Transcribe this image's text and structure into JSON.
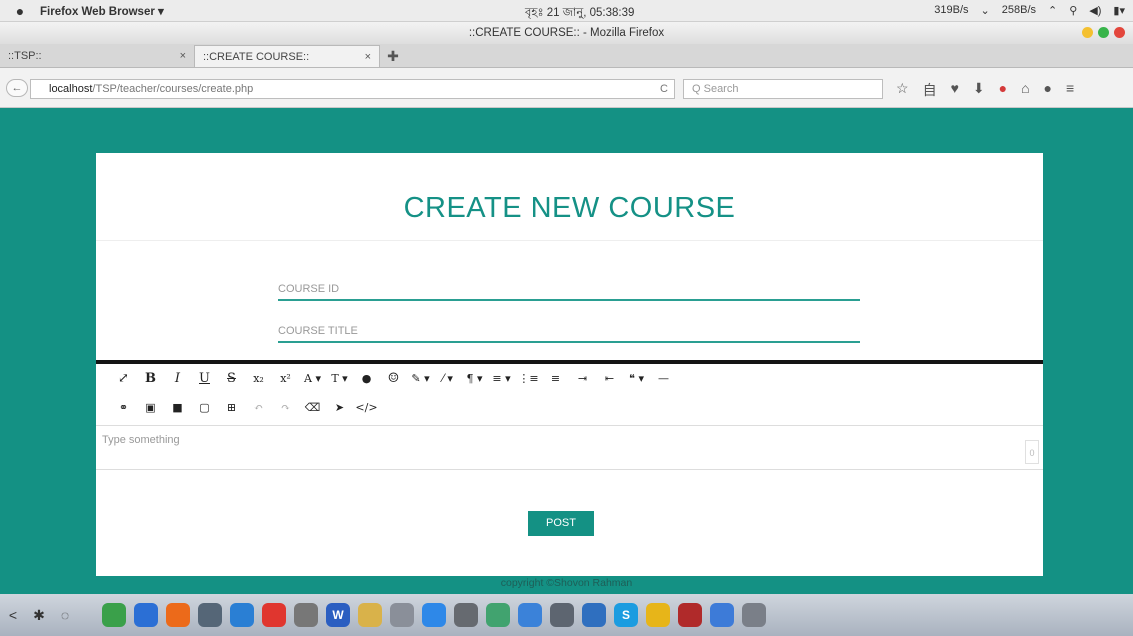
{
  "menubar": {
    "app_name": "Firefox Web Browser ▾",
    "clock": "বৃহঃ 21 জানু, 05:38:39",
    "status": [
      "319B/s",
      "⌄",
      "258B/s",
      "⌃",
      "⚲",
      "◀)",
      "▮▾"
    ]
  },
  "window": {
    "title": "::CREATE COURSE:: - Mozilla Firefox"
  },
  "tabs": [
    {
      "label": "::TSP::",
      "close": "×"
    },
    {
      "label": "::CREATE COURSE::",
      "close": "×"
    }
  ],
  "newtab_label": "✚",
  "nav": {
    "back": "←",
    "url_host": "localhost",
    "url_path": "/TSP/teacher/courses/create.php",
    "reload": "C",
    "search_placeholder": "Q Search",
    "icons": [
      "star-icon",
      "reading-list-icon",
      "pocket-icon",
      "download-icon",
      "addon-icon",
      "home-icon",
      "chat-icon",
      "menu-icon"
    ],
    "icon_glyphs": [
      "☆",
      "自",
      "♥",
      "⬇",
      "●",
      "⌂",
      "●",
      "≡"
    ]
  },
  "form": {
    "heading": "CREATE NEW COURSE",
    "course_id_placeholder": "COURSE ID",
    "course_title_placeholder": "COURSE TITLE",
    "editor_placeholder": "Type something",
    "editor_counter": "0",
    "post_button": "POST"
  },
  "toolbar": {
    "row1": [
      "⤢",
      "B",
      "I",
      "U",
      "S",
      "x₂",
      "x²",
      "A ▾",
      "T ▾",
      "●",
      "☺",
      "✎ ▾",
      "⁄ ▾",
      "¶ ▾",
      "≡ ▾",
      "⋮≡",
      "≡",
      "⇥",
      "⇤",
      "❝ ▾",
      "—"
    ],
    "row2": [
      "⚭",
      "▣",
      "■",
      "▢",
      "⊞",
      "↶",
      "↷",
      "⌫",
      "➤",
      "</>"
    ]
  },
  "footer": "copyright ©Shovon Rahman",
  "dock": {
    "left_controls": [
      "<",
      "✱",
      "◌"
    ],
    "apps": [
      "green",
      "blue",
      "orange",
      "gray",
      "blue2",
      "red",
      "gray2",
      "blue3",
      "gold",
      "gray3",
      "blue4",
      "gray5",
      "green2",
      "blue5",
      "gray6",
      "blue6",
      "skype",
      "chrome",
      "maroon",
      "blue7",
      "gray7"
    ],
    "app_colors": [
      "#3aa04a",
      "#2b6fd5",
      "#ec6a1a",
      "#556677",
      "#2a7fd4",
      "#e0362f",
      "#777777",
      "#2b5ec1",
      "#d9b24a",
      "#8a8f99",
      "#2e88e8",
      "#666a70",
      "#41a36f",
      "#3b82d9",
      "#5d6570",
      "#2f6fbf",
      "#1b9ce0",
      "#e7b519",
      "#b02a2a",
      "#3d7bd8",
      "#7a7f88"
    ],
    "app_labels": [
      "",
      "",
      "",
      "",
      "",
      "",
      "",
      "W",
      "",
      "",
      "",
      "",
      "",
      "",
      "",
      "",
      "S",
      "",
      "",
      "",
      ""
    ]
  }
}
